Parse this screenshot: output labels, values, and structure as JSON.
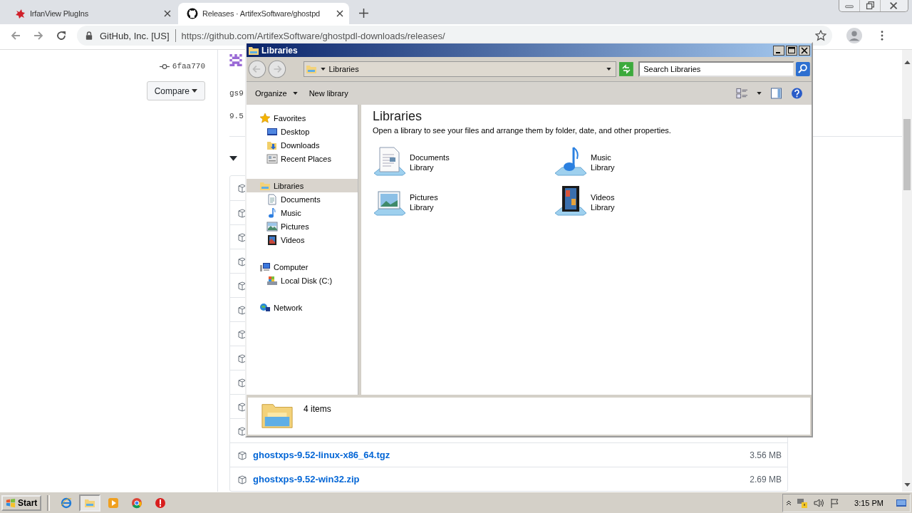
{
  "browser": {
    "tabs": [
      {
        "title": "IrfanView PlugIns",
        "kind": "irfan",
        "selected": false
      },
      {
        "title": "Releases · ArtifexSoftware/ghostpd",
        "kind": "github",
        "selected": true
      }
    ],
    "address": {
      "site": "GitHub, Inc. [US]",
      "url": "https://github.com/ArtifexSoftware/ghostpdl-downloads/releases/"
    }
  },
  "page": {
    "commit": "6faa770",
    "compare_button": "Compare",
    "release_fragments": [
      "gs9",
      "9.5"
    ],
    "assets": [
      {
        "name": "ghostxps-9.52-linux-x86_64.tgz",
        "size": "3.56 MB"
      },
      {
        "name": "ghostxps-9.52-win32.zip",
        "size": "2.69 MB"
      }
    ]
  },
  "explorer": {
    "title": "Libraries",
    "breadcrumb": "Libraries",
    "search_placeholder": "Search Libraries",
    "commands": [
      {
        "label": "Organize",
        "menu": true
      },
      {
        "label": "New library",
        "menu": false
      }
    ],
    "nav": [
      {
        "label": "Favorites",
        "kind": "star",
        "selected": false,
        "children": [
          {
            "label": "Desktop",
            "kind": "desktop",
            "selected": false
          },
          {
            "label": "Downloads",
            "kind": "downloads",
            "selected": false
          },
          {
            "label": "Recent Places",
            "kind": "recent",
            "selected": false
          }
        ]
      },
      {
        "label": "Libraries",
        "kind": "libraries",
        "selected": true,
        "children": [
          {
            "label": "Documents",
            "kind": "documents",
            "selected": false
          },
          {
            "label": "Music",
            "kind": "music",
            "selected": false
          },
          {
            "label": "Pictures",
            "kind": "pictures",
            "selected": false
          },
          {
            "label": "Videos",
            "kind": "videos",
            "selected": false
          }
        ]
      },
      {
        "label": "Computer",
        "kind": "computer",
        "selected": false,
        "children": [
          {
            "label": "Local Disk (C:)",
            "kind": "disk",
            "selected": false
          }
        ]
      },
      {
        "label": "Network",
        "kind": "network",
        "selected": false
      }
    ],
    "heading": "Libraries",
    "subtitle": "Open a library to see your files and arrange them by folder, date, and other properties.",
    "libraries": [
      {
        "name": "Documents",
        "type": "Library",
        "kind": "documents"
      },
      {
        "name": "Music",
        "type": "Library",
        "kind": "music"
      },
      {
        "name": "Pictures",
        "type": "Library",
        "kind": "pictures"
      },
      {
        "name": "Videos",
        "type": "Library",
        "kind": "videos"
      }
    ],
    "status": "4 items"
  },
  "taskbar": {
    "start": "Start",
    "apps": [
      {
        "kind": "ie",
        "selected": false
      },
      {
        "kind": "explorer",
        "selected": true
      },
      {
        "kind": "media",
        "selected": false
      },
      {
        "kind": "chrome",
        "selected": false
      },
      {
        "kind": "stop",
        "selected": false
      }
    ],
    "clock": "3:15 PM"
  }
}
